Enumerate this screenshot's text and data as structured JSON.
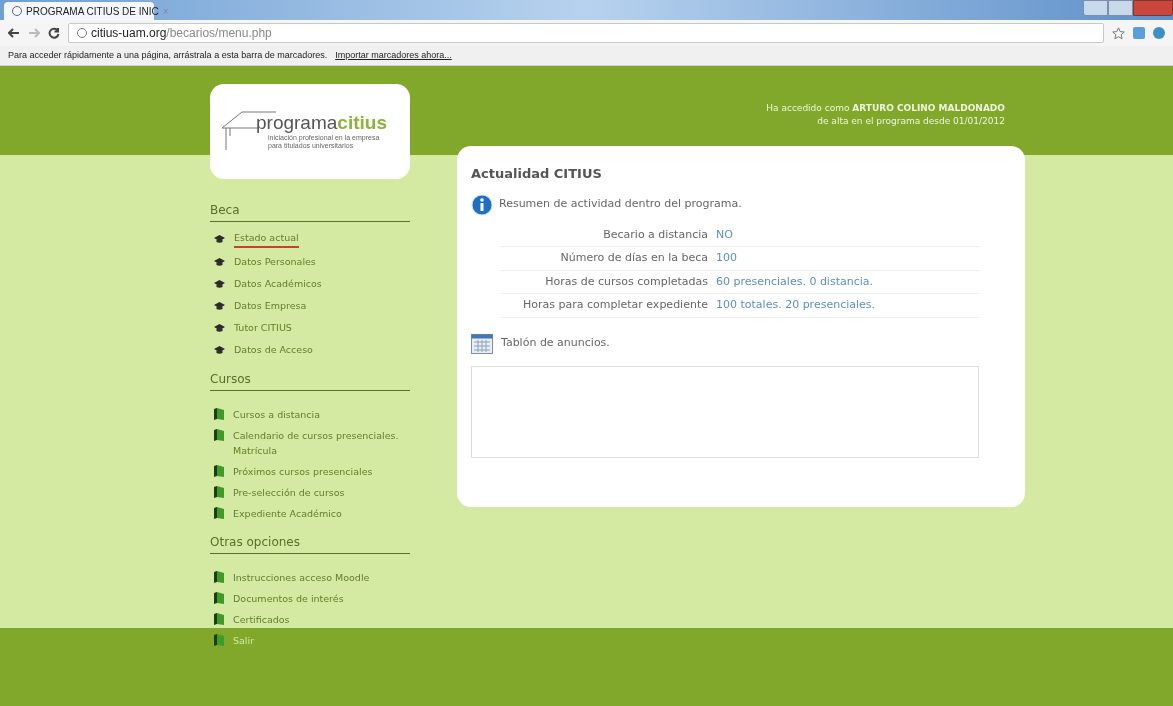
{
  "browser": {
    "tab": {
      "title": "PROGRAMA CITIUS DE INIC",
      "close": "×"
    },
    "url": {
      "host": "citius-uam.org",
      "path": "/becarios/menu.php"
    },
    "bookmarks_bar": {
      "message": "Para acceder rápidamente a una página, arrástrala a esta barra de marcadores.",
      "link": "Importar marcadores ahora..."
    }
  },
  "header": {
    "logo": {
      "name_light": "programa",
      "name_bold": "citius",
      "tagline_1": "iniciación profesional en la empresa",
      "tagline_2": "para titulados universitarios"
    },
    "user_line": "Ha accedido como **ARTURO COLINO MALDONADO**",
    "since_line": "de alta en el programa desde 01/01/2012"
  },
  "sidebar": {
    "sections": [
      {
        "title": "Beca",
        "items": [
          {
            "label": "Estado actual",
            "kind": "cap",
            "selected": true
          },
          {
            "label": "Datos Personales",
            "kind": "cap",
            "selected": false
          },
          {
            "label": "Datos Académicos",
            "kind": "cap",
            "selected": false
          },
          {
            "label": "Datos Empresa",
            "kind": "cap",
            "selected": false
          },
          {
            "label": "Tutor CITIUS",
            "kind": "cap",
            "selected": false
          },
          {
            "label": "Datos de Acceso",
            "kind": "cap",
            "selected": false
          }
        ]
      },
      {
        "title": "Cursos",
        "items": [
          {
            "label": "Cursos a distancia",
            "kind": "book",
            "selected": false
          },
          {
            "label": "Calendario de cursos presenciales. Matrícula",
            "kind": "book",
            "selected": false
          },
          {
            "label": "Próximos cursos presenciales",
            "kind": "book",
            "selected": false
          },
          {
            "label": "Pre-selección de cursos",
            "kind": "book",
            "selected": false
          },
          {
            "label": "Expediente Académico",
            "kind": "book",
            "selected": false
          }
        ]
      },
      {
        "title": "Otras opciones",
        "items": [
          {
            "label": "Instrucciones acceso Moodle",
            "kind": "book",
            "selected": false
          },
          {
            "label": "Documentos de interés",
            "kind": "book",
            "selected": false
          },
          {
            "label": "Certificados",
            "kind": "book",
            "selected": false
          },
          {
            "label": "Salir",
            "kind": "book",
            "selected": false
          }
        ]
      }
    ]
  },
  "main": {
    "title": "Actualidad CITIUS",
    "summary": "Resumen de actividad dentro del programa.",
    "rows": [
      {
        "label": "Becario a distancia",
        "value": "NO"
      },
      {
        "label": "Número de días en la beca",
        "value": "100"
      },
      {
        "label": "Horas de cursos completadas",
        "value": "60 presenciales. 0 distancia."
      },
      {
        "label": "Horas para completar expediente",
        "value": "100 totales. 20 presenciales."
      }
    ],
    "board_title": "Tablón de anuncios."
  }
}
